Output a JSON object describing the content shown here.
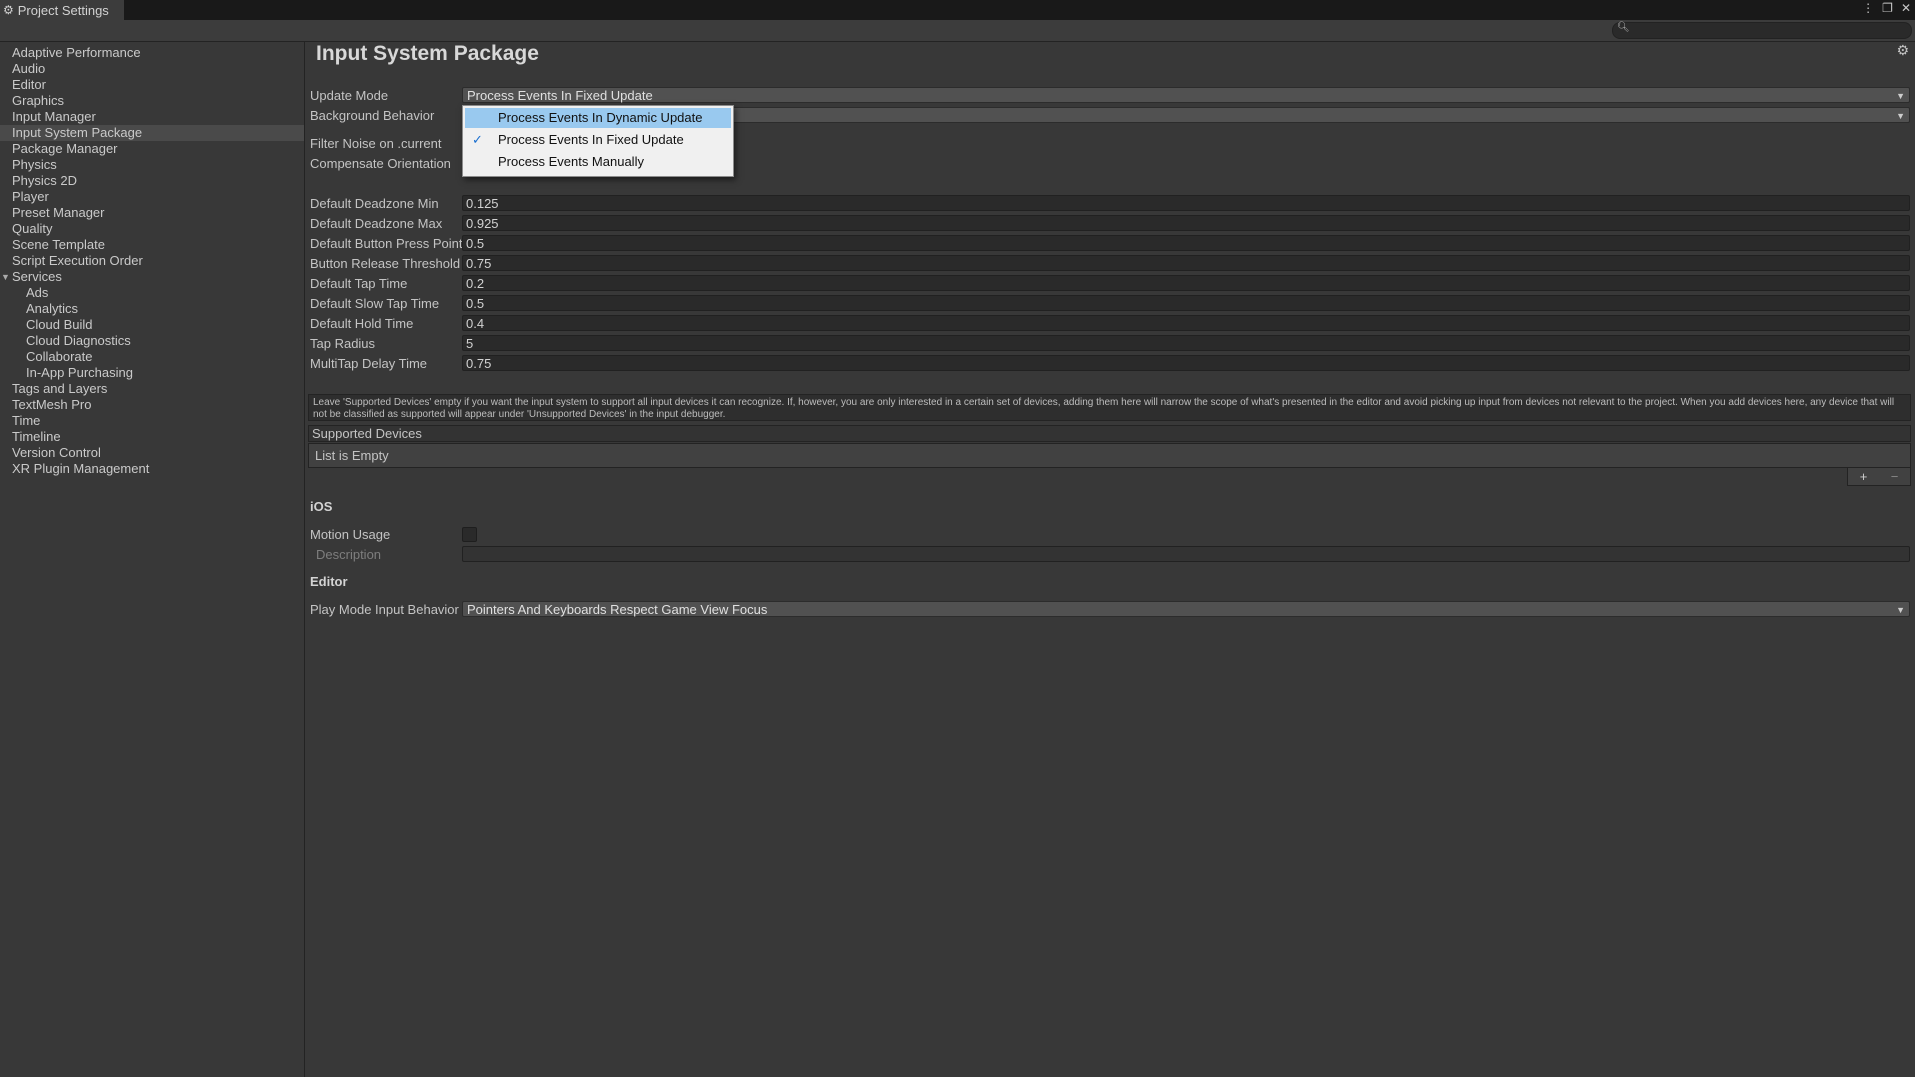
{
  "window": {
    "title": "Project Settings",
    "controls": [
      "⋮",
      "❐",
      "✕"
    ]
  },
  "sidebar": {
    "items": [
      {
        "label": "Adaptive Performance"
      },
      {
        "label": "Audio"
      },
      {
        "label": "Editor"
      },
      {
        "label": "Graphics"
      },
      {
        "label": "Input Manager"
      },
      {
        "label": "Input System Package",
        "selected": true
      },
      {
        "label": "Package Manager"
      },
      {
        "label": "Physics"
      },
      {
        "label": "Physics 2D"
      },
      {
        "label": "Player"
      },
      {
        "label": "Preset Manager"
      },
      {
        "label": "Quality"
      },
      {
        "label": "Scene Template"
      },
      {
        "label": "Script Execution Order"
      },
      {
        "label": "Services",
        "expanded": true
      },
      {
        "label": "Ads",
        "child": true
      },
      {
        "label": "Analytics",
        "child": true
      },
      {
        "label": "Cloud Build",
        "child": true
      },
      {
        "label": "Cloud Diagnostics",
        "child": true
      },
      {
        "label": "Collaborate",
        "child": true
      },
      {
        "label": "In-App Purchasing",
        "child": true
      },
      {
        "label": "Tags and Layers"
      },
      {
        "label": "TextMesh Pro"
      },
      {
        "label": "Time"
      },
      {
        "label": "Timeline"
      },
      {
        "label": "Version Control"
      },
      {
        "label": "XR Plugin Management"
      }
    ]
  },
  "main": {
    "title": "Input System Package",
    "update_mode": {
      "label": "Update Mode",
      "value": "Process Events In Fixed Update"
    },
    "background_behavior": {
      "label": "Background Behavior"
    },
    "filter_noise": {
      "label": "Filter Noise on .current"
    },
    "compensate_orientation": {
      "label": "Compensate Orientation"
    },
    "numeric_fields": [
      {
        "label": "Default Deadzone Min",
        "value": "0.125"
      },
      {
        "label": "Default Deadzone Max",
        "value": "0.925"
      },
      {
        "label": "Default Button Press Point",
        "value": "0.5"
      },
      {
        "label": "Button Release Threshold",
        "value": "0.75"
      },
      {
        "label": "Default Tap Time",
        "value": "0.2"
      },
      {
        "label": "Default Slow Tap Time",
        "value": "0.5"
      },
      {
        "label": "Default Hold Time",
        "value": "0.4"
      },
      {
        "label": "Tap Radius",
        "value": "5"
      },
      {
        "label": "MultiTap Delay Time",
        "value": "0.75"
      }
    ],
    "help_text": "Leave 'Supported Devices' empty if you want the input system to support all input devices it can recognize. If, however, you are only interested in a certain set of devices, adding them here will narrow the scope of what's presented in the editor and avoid picking up input from devices not relevant to the project. When you add devices here, any device that will not be classified as supported will appear under 'Unsupported Devices' in the input debugger.",
    "supported_devices": {
      "header": "Supported Devices",
      "empty_text": "List is Empty",
      "add": "+",
      "remove": "−"
    },
    "ios": {
      "heading": "iOS",
      "motion_usage": "Motion Usage",
      "description": "Description"
    },
    "editor": {
      "heading": "Editor",
      "play_mode_label": "Play Mode Input Behavior",
      "play_mode_value": "Pointers And Keyboards Respect Game View Focus"
    }
  },
  "popup": {
    "options": [
      {
        "label": "Process Events In Dynamic Update",
        "highlighted": true,
        "checked": false
      },
      {
        "label": "Process Events In Fixed Update",
        "highlighted": false,
        "checked": true
      },
      {
        "label": "Process Events Manually",
        "highlighted": false,
        "checked": false
      }
    ]
  },
  "colors": {
    "background": "#383838",
    "highlight": "#99c9ef",
    "check": "#1a6fd0"
  }
}
